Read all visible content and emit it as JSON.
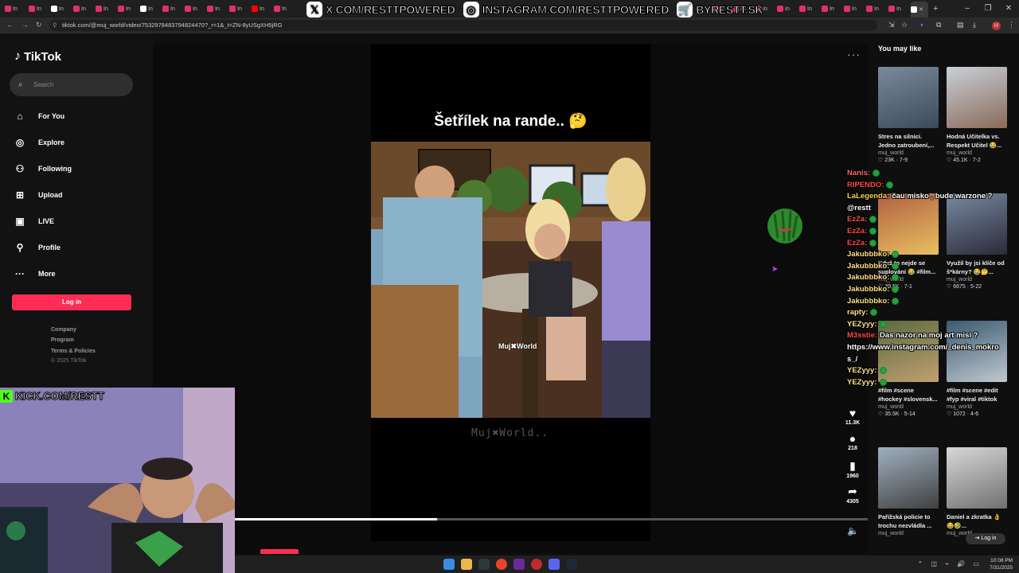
{
  "browser": {
    "url": "tiktok.com/@muj_world/video/7532978483794824470?_r=1&_t=ZN-8yUSgXH5jRG",
    "tab_label": "In",
    "window_controls": [
      "–",
      "❐",
      "✕"
    ]
  },
  "stream_overlay": {
    "banner_x": "X.COM/RESTTPOWERED",
    "banner_instagram": "INSTAGRAM.COM/RESTTPOWERED",
    "banner_shop": "BYRESTT.SK",
    "kick": "KICK.COM/RESTT"
  },
  "sidebar": {
    "logo": "TikTok",
    "search_placeholder": "Search",
    "items": [
      {
        "label": "For You",
        "icon": "home-icon"
      },
      {
        "label": "Explore",
        "icon": "compass-icon"
      },
      {
        "label": "Following",
        "icon": "following-icon"
      },
      {
        "label": "Upload",
        "icon": "upload-icon"
      },
      {
        "label": "LIVE",
        "icon": "live-icon"
      },
      {
        "label": "Profile",
        "icon": "profile-icon"
      },
      {
        "label": "More",
        "icon": "more-icon"
      }
    ],
    "login": "Log in",
    "footer": [
      "Company",
      "Program",
      "Terms & Policies",
      "© 2025 TikTok"
    ]
  },
  "video": {
    "caption": "Šetřílek na rande.. 🤔",
    "watermark_inside": "Muj✖World",
    "watermark_below": "Muj✖World..",
    "progress": 0.32,
    "actions": [
      {
        "name": "like",
        "icon": "heart-icon",
        "count": "11.3K"
      },
      {
        "name": "comment",
        "icon": "comment-icon",
        "count": "218"
      },
      {
        "name": "bookmark",
        "icon": "bookmark-icon",
        "count": "1960"
      },
      {
        "name": "share",
        "icon": "share-icon",
        "count": "4305"
      }
    ]
  },
  "right": {
    "heading": "You may like",
    "recs": [
      {
        "title": "Stres na silnici. Jedno zatroubení,...",
        "author": "muj_world",
        "stats": "♡ 23K · 7-9"
      },
      {
        "title": "Hodná Učitelka vs. Respekt Učitel 😂...",
        "author": "muj_world",
        "stats": "♡ 45.1K · 7-2"
      },
      {
        "title": "Když to nejde se suplování 😂 #film...",
        "author": "muj_world",
        "stats": "♡ 39.5K · 7-1"
      },
      {
        "title": "Využil by jsi klíče od š*kárny? 😂🤔...",
        "author": "muj_world",
        "stats": "♡ 6675 · 5-22"
      },
      {
        "title": "#film #scene #hockey #slovensk...",
        "author": "muj_world",
        "stats": "♡ 35.5K · 5-14"
      },
      {
        "title": "#film #scene #edit #fyp #viral #tiktok",
        "author": "muj_world",
        "stats": "♡ 1072 · 4-6"
      },
      {
        "title": "Pařížská policie to trochu nezvládla ...",
        "author": "muj_world",
        "stats": ""
      },
      {
        "title": "Daniel a zkratka 👌 😂🤣...",
        "author": "muj_world",
        "stats": ""
      }
    ],
    "login": "Log in"
  },
  "chat": [
    {
      "user": "Nanis:",
      "color": "#ff6b6b",
      "msg": ""
    },
    {
      "user": "RIPENDO:",
      "color": "#ff4a4a",
      "msg": ""
    },
    {
      "user": "LaLegenda:",
      "color": "#ffd24a",
      "msg": "čau misko , bude warzone ?"
    },
    {
      "user": "@restt",
      "color": "#ffffff",
      "msg": ""
    },
    {
      "user": "EzZa:",
      "color": "#ff4a4a",
      "msg": ""
    },
    {
      "user": "EzZa:",
      "color": "#ff4a4a",
      "msg": ""
    },
    {
      "user": "EzZa:",
      "color": "#ff4a4a",
      "msg": ""
    },
    {
      "user": "Jakubbbko:",
      "color": "#ffe08a",
      "msg": ""
    },
    {
      "user": "Jakubbbko:",
      "color": "#ffe08a",
      "msg": ""
    },
    {
      "user": "Jakubbbko:",
      "color": "#ffe08a",
      "msg": ""
    },
    {
      "user": "Jakubbbko:",
      "color": "#ffe08a",
      "msg": ""
    },
    {
      "user": "Jakubbbko:",
      "color": "#ffe08a",
      "msg": ""
    },
    {
      "user": "rapty:",
      "color": "#ffe08a",
      "msg": ""
    },
    {
      "user": "YEZyyy:",
      "color": "#ffe08a",
      "msg": ""
    },
    {
      "user": "M3sstie:",
      "color": "#ff4a4a",
      "msg": "Das nazor na moj art misi ?"
    },
    {
      "user": "",
      "color": "#ffffff",
      "msg": "https://www.instagram.com/_denis_mokro"
    },
    {
      "user": "",
      "color": "#ffffff",
      "msg": "s_/"
    },
    {
      "user": "YEZyyy:",
      "color": "#ffe08a",
      "msg": ""
    },
    {
      "user": "YEZyyy:",
      "color": "#ffe08a",
      "msg": ""
    }
  ],
  "taskbar": {
    "time": "10:08 PM",
    "date": "7/31/2025",
    "tray": "⌃ ◫ ⌁ 🔊 ▭"
  }
}
